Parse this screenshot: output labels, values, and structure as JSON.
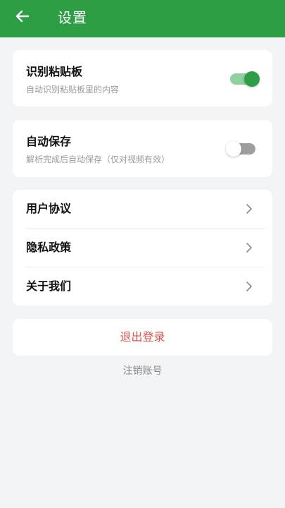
{
  "header": {
    "title": "设置",
    "back_icon": "arrow-left-icon",
    "background_color": "#2e9e45"
  },
  "settings": {
    "clipboard": {
      "title": "识别粘贴板",
      "subtitle": "自动识别粘贴板里的内容",
      "enabled": true
    },
    "autosave": {
      "title": "自动保存",
      "subtitle": "解析完成后自动保存（仅对视频有效）",
      "enabled": false
    }
  },
  "links": [
    {
      "label": "用户协议",
      "icon": "chevron-right-icon"
    },
    {
      "label": "隐私政策",
      "icon": "chevron-right-icon"
    },
    {
      "label": "关于我们",
      "icon": "chevron-right-icon"
    }
  ],
  "actions": {
    "logout_label": "退出登录",
    "logout_color": "#d9534f",
    "cancel_account_label": "注销账号"
  }
}
